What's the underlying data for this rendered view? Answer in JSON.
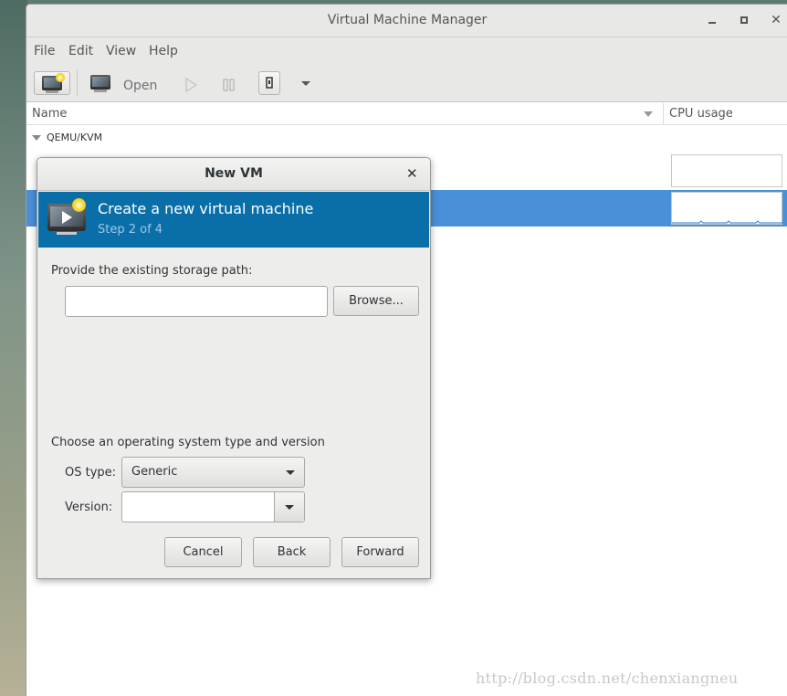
{
  "window": {
    "title": "Virtual Machine Manager"
  },
  "menu": [
    "File",
    "Edit",
    "View",
    "Help"
  ],
  "toolbar": {
    "open_label": "Open"
  },
  "list": {
    "col_name": "Name",
    "col_cpu": "CPU usage",
    "group": "QEMU/KVM"
  },
  "dialog": {
    "title": "New VM",
    "heading": "Create a new virtual machine",
    "step": "Step 2 of 4",
    "storage_label": "Provide the existing storage path:",
    "storage_value": "",
    "browse_label": "Browse...",
    "os_section_label": "Choose an operating system type and version",
    "os_type_label": "OS type:",
    "os_type_value": "Generic",
    "version_label": "Version:",
    "version_value": "",
    "cancel_label": "Cancel",
    "back_label": "Back",
    "forward_label": "Forward"
  },
  "colors": {
    "selection": "#4a90d9",
    "banner": "#0a6fa8",
    "banner_step": "#9ec7e6"
  },
  "watermark": "http://blog.csdn.net/chenxiangneu"
}
